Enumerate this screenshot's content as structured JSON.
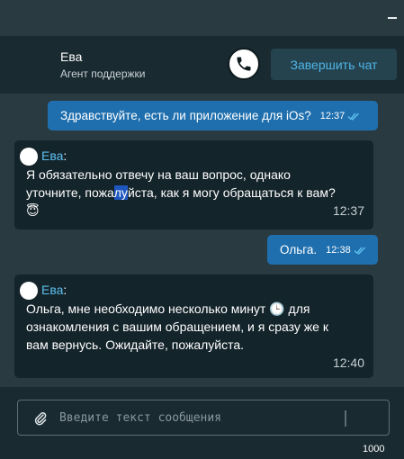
{
  "header": {
    "agent_name": "Ева",
    "agent_role": "Агент поддержки",
    "end_chat_label": "Завершить чат"
  },
  "messages": [
    {
      "direction": "out",
      "text": "Здравствуйте, есть ли приложение для iOs?",
      "time": "12:37",
      "status": "read"
    },
    {
      "direction": "in",
      "sender": "Ева",
      "sender_suffix": ":",
      "text_before": "Я обязательно отвечу на ваш вопрос, однако уточните, пожа",
      "text_highlight": "лу",
      "text_after": "йста, как я могу обращаться к вам? 😇",
      "time": "12:37"
    },
    {
      "direction": "out",
      "text": "Ольга.",
      "time": "12:38",
      "status": "read"
    },
    {
      "direction": "in",
      "sender": "Ева",
      "sender_suffix": ":",
      "text_before": "Ольга, мне необходимо несколько минут 🕒 для ознакомления с вашим обращением, и я сразу же к вам вернусь. Ожидайте, пожалуйста.",
      "time": "12:40"
    }
  ],
  "composer": {
    "placeholder": "Введите текст сообщения",
    "value": "",
    "char_limit": "1000"
  },
  "icons": {
    "minimize": "minimize-icon",
    "call": "phone-icon",
    "read_status": "double-check-icon",
    "attach": "paperclip-icon"
  },
  "colors": {
    "background": "#2a3a41",
    "header": "#1a2a31",
    "outgoing_bubble": "#1f6fae",
    "incoming_bubble": "#14242b",
    "accent": "#5cc0ee",
    "read_check": "#5cc0ee"
  }
}
